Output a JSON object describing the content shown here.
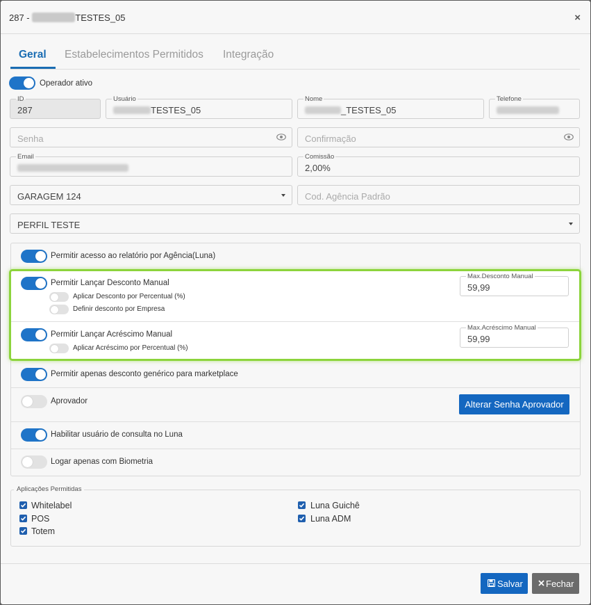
{
  "dialog": {
    "title_prefix": "287 -",
    "title_suffix": "TESTES_05",
    "close_label": "×"
  },
  "tabs": [
    {
      "label": "Geral",
      "active": true
    },
    {
      "label": "Estabelecimentos Permitidos",
      "active": false
    },
    {
      "label": "Integração",
      "active": false
    }
  ],
  "operador_ativo": {
    "label": "Operador ativo",
    "on": true
  },
  "fields": {
    "id": {
      "label": "ID",
      "value": "287"
    },
    "usuario": {
      "label": "Usuário",
      "value": "TESTES_05"
    },
    "nome": {
      "label": "Nome",
      "value": "_TESTES_05"
    },
    "telefone": {
      "label": "Telefone",
      "value": ""
    },
    "senha": {
      "placeholder": "Senha"
    },
    "confirmacao": {
      "placeholder": "Confirmação"
    },
    "email": {
      "label": "Email",
      "value": ""
    },
    "comissao": {
      "label": "Comissão",
      "value": "2,00%"
    },
    "garagem": {
      "value": "GARAGEM 124"
    },
    "cod_agencia": {
      "placeholder": "Cod. Agência Padrão"
    },
    "perfil": {
      "value": "PERFIL TESTE"
    }
  },
  "permissions": {
    "relatorio": {
      "label": "Permitir acesso ao relatório por Agência(Luna)",
      "on": true
    },
    "desconto": {
      "label": "Permitir Lançar Desconto Manual",
      "on": true
    },
    "desconto_percentual": {
      "label": "Aplicar Desconto por Percentual (%)",
      "on": false
    },
    "desconto_empresa": {
      "label": "Definir desconto por Empresa",
      "on": false
    },
    "max_desconto": {
      "label": "Max.Desconto Manual",
      "value": "59,99"
    },
    "acrescimo": {
      "label": "Permitir Lançar Acréscimo Manual",
      "on": true
    },
    "acrescimo_percentual": {
      "label": "Aplicar Acréscimo por Percentual (%)",
      "on": false
    },
    "max_acrescimo": {
      "label": "Max.Acréscimo Manual",
      "value": "59,99"
    },
    "marketplace": {
      "label": "Permitir apenas desconto genérico para marketplace",
      "on": true
    },
    "aprovador": {
      "label": "Aprovador",
      "on": false
    },
    "alterar_senha": {
      "label": "Alterar Senha Aprovador"
    },
    "consulta_luna": {
      "label": "Habilitar usuário de consulta no Luna",
      "on": true
    },
    "biometria": {
      "label": "Logar apenas com Biometria",
      "on": false
    }
  },
  "aplicacoes": {
    "legend": "Aplicações Permitidas",
    "items": [
      {
        "label": "Whitelabel",
        "checked": true
      },
      {
        "label": "POS",
        "checked": true
      },
      {
        "label": "Totem",
        "checked": true
      },
      {
        "label": "Luna Guichê",
        "checked": true
      },
      {
        "label": "Luna ADM",
        "checked": true
      }
    ]
  },
  "footer": {
    "save_label": "Salvar",
    "close_label": "Fechar"
  },
  "colors": {
    "accent": "#1f74c8",
    "highlight": "#8cd43c",
    "close_button": "#6b6b6b"
  }
}
